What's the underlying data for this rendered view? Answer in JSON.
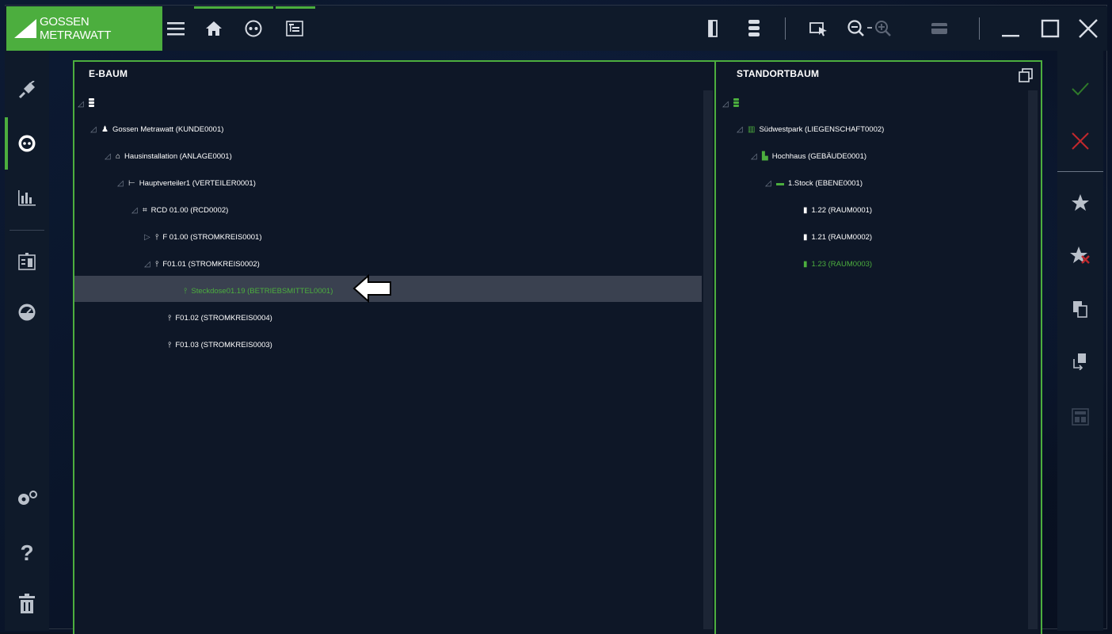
{
  "topbar": {
    "logo_text": "GOSSEN METRAWATT",
    "icons": [
      "menu-icon",
      "home-icon",
      "socket-icon",
      "tree-view-icon",
      "panel-icon",
      "database-icon",
      "select-icon",
      "zoom-out-icon",
      "zoom-in-icon",
      "card-icon",
      "minimize-icon",
      "maximize-icon",
      "close-icon"
    ]
  },
  "left_panel": {
    "title": "E-BAUM",
    "nodes": [
      {
        "label": "Gossen Metrawatt (KUNDE0001)"
      },
      {
        "label": "Hausinstallation (ANLAGE0001)"
      },
      {
        "label": "Hauptverteiler1 (VERTEILER0001)"
      },
      {
        "label": "RCD  01.00 (RCD0002)"
      },
      {
        "label": "F 01.00 (STROMKREIS0001)"
      },
      {
        "label": "F01.01 (STROMKREIS0002)"
      },
      {
        "label": "Steckdose01.19 (BETRIEBSMITTEL0001)"
      },
      {
        "label": "F01.02 (STROMKREIS0004)"
      },
      {
        "label": "F01.03 (STROMKREIS0003)"
      }
    ]
  },
  "right_panel": {
    "title": "STANDORTBAUM",
    "nodes": [
      {
        "label": "Südwestpark (LIEGENSCHAFT0002)"
      },
      {
        "label": "Hochhaus (GEBÄUDE0001)"
      },
      {
        "label": "1.Stock (EBENE0001)"
      },
      {
        "label": "1.22 (RAUM0001)"
      },
      {
        "label": "1.21 (RAUM0002)"
      },
      {
        "label": "1.23 (RAUM0003)"
      }
    ]
  },
  "colors": {
    "accent": "#4cae3e",
    "background": "#0e1727",
    "selected_row": "#3a4150",
    "danger": "#c0282d"
  }
}
